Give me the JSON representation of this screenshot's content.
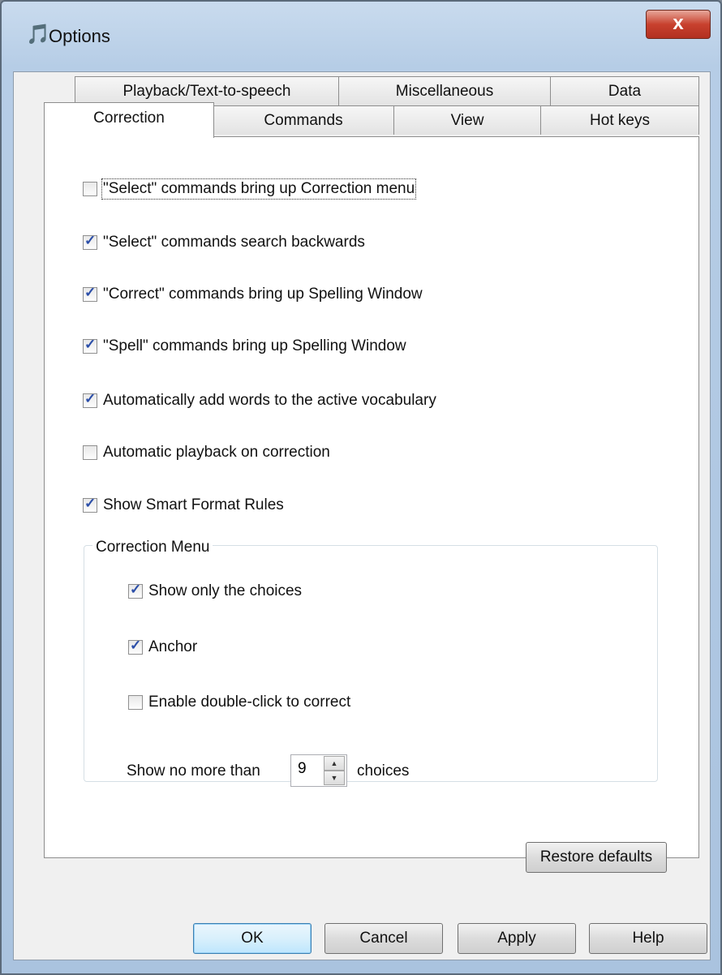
{
  "window": {
    "title": "Options",
    "close_label": "x"
  },
  "tabs_row1": [
    "Playback/Text-to-speech",
    "Miscellaneous",
    "Data"
  ],
  "tabs_row2": [
    "Correction",
    "Commands",
    "View",
    "Hot keys"
  ],
  "options": [
    {
      "label": "\"Select\" commands bring up Correction menu",
      "checked": false
    },
    {
      "label": "\"Select\" commands search backwards",
      "checked": true
    },
    {
      "label": "\"Correct\" commands bring up Spelling Window",
      "checked": true
    },
    {
      "label": "\"Spell\" commands bring up Spelling Window",
      "checked": true
    },
    {
      "label": "Automatically add words to the active vocabulary",
      "checked": true
    },
    {
      "label": "Automatic playback on correction",
      "checked": false
    },
    {
      "label": "Show Smart Format Rules",
      "checked": true
    }
  ],
  "correction_menu": {
    "title": "Correction Menu",
    "options": [
      {
        "label": "Show only the choices",
        "checked": true
      },
      {
        "label": "Anchor",
        "checked": true
      },
      {
        "label": "Enable double-click to correct",
        "checked": false
      }
    ],
    "show_no_more_than_label": "Show no more than",
    "choices_value": "9",
    "choices_label": "choices"
  },
  "buttons": {
    "restore": "Restore defaults",
    "ok": "OK",
    "cancel": "Cancel",
    "apply": "Apply",
    "help": "Help"
  }
}
